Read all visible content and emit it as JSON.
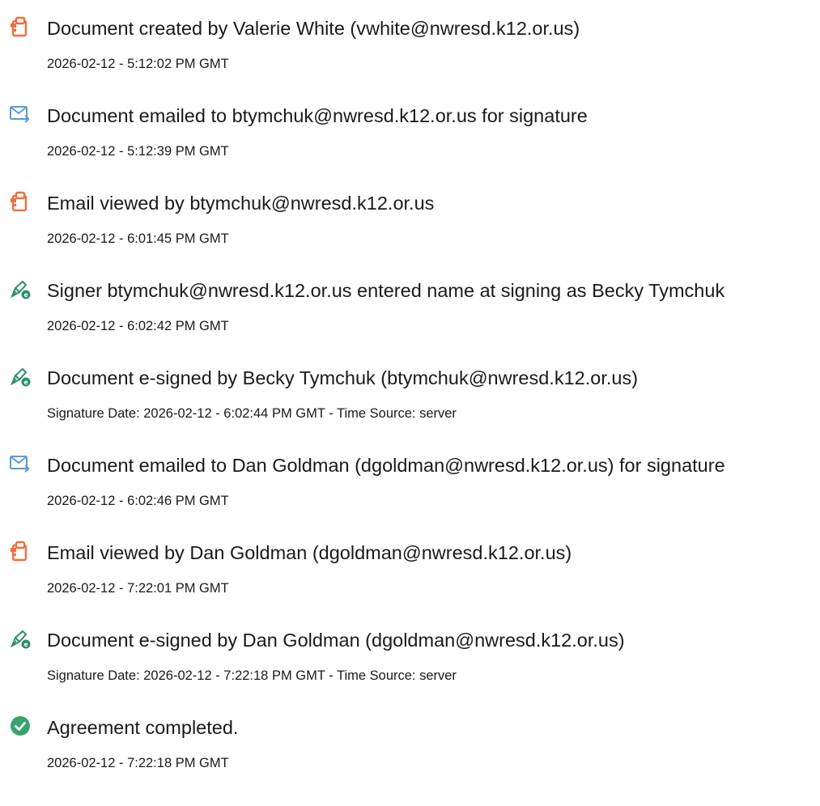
{
  "events": [
    {
      "icon": "document-created-icon",
      "title": "Document created by Valerie White (vwhite@nwresd.k12.or.us)",
      "subtitle": "2026-02-12 - 5:12:02 PM GMT"
    },
    {
      "icon": "email-sent-icon",
      "title": "Document emailed to btymchuk@nwresd.k12.or.us for signature",
      "subtitle": "2026-02-12 - 5:12:39 PM GMT"
    },
    {
      "icon": "document-viewed-icon",
      "title": "Email viewed by btymchuk@nwresd.k12.or.us",
      "subtitle": "2026-02-12 - 6:01:45 PM GMT"
    },
    {
      "icon": "esign-pen-icon",
      "title": "Signer btymchuk@nwresd.k12.or.us entered name at signing as Becky Tymchuk",
      "subtitle": "2026-02-12 - 6:02:42 PM GMT"
    },
    {
      "icon": "esign-pen-icon",
      "title": "Document e-signed by Becky Tymchuk (btymchuk@nwresd.k12.or.us)",
      "subtitle": "Signature Date: 2026-02-12 - 6:02:44 PM GMT - Time Source: server"
    },
    {
      "icon": "email-sent-icon",
      "title": "Document emailed to Dan Goldman (dgoldman@nwresd.k12.or.us) for signature",
      "subtitle": "2026-02-12 - 6:02:46 PM GMT"
    },
    {
      "icon": "document-viewed-icon",
      "title": "Email viewed by Dan Goldman (dgoldman@nwresd.k12.or.us)",
      "subtitle": "2026-02-12 - 7:22:01 PM GMT"
    },
    {
      "icon": "esign-pen-icon",
      "title": "Document e-signed by Dan Goldman (dgoldman@nwresd.k12.or.us)",
      "subtitle": "Signature Date: 2026-02-12 - 7:22:18 PM GMT - Time Source: server"
    },
    {
      "icon": "checkmark-circle-icon",
      "title": "Agreement completed.",
      "subtitle": "2026-02-12 - 7:22:18 PM GMT"
    }
  ],
  "colors": {
    "doc_icon": "#f26d3d",
    "email_icon": "#5b9bd5",
    "pen_icon": "#2e8f63",
    "check_icon": "#3aa26f",
    "text": "#1a1a1a"
  }
}
